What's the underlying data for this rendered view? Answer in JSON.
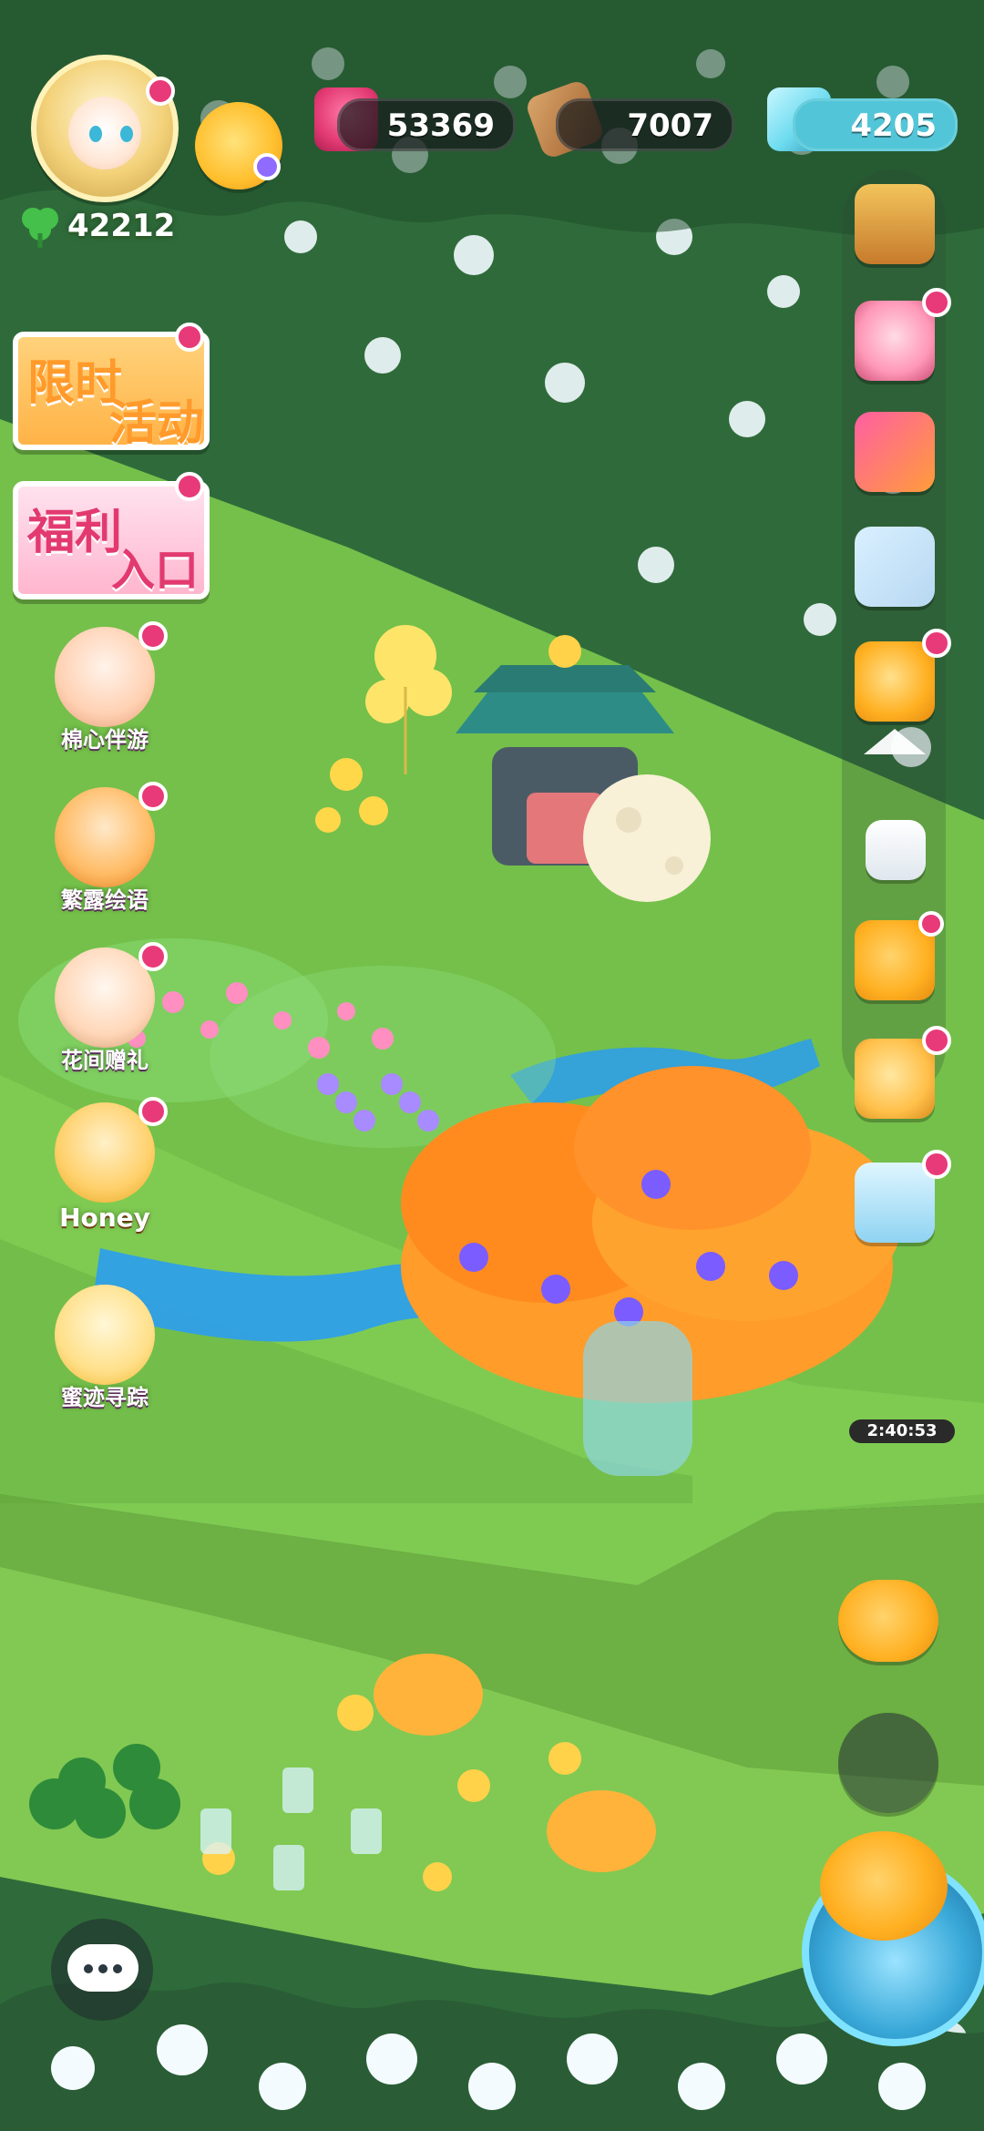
{
  "hud": {
    "player_level": "42212",
    "resources": {
      "jam": "53369",
      "wood": "7007",
      "gems": "4205"
    }
  },
  "left_menu": {
    "limited_event": {
      "line1": "限时",
      "line2": "活动"
    },
    "welfare": {
      "line1": "福利",
      "line2": "入口"
    },
    "items": [
      {
        "label": "棉心伴游"
      },
      {
        "label": "繁露绘语"
      },
      {
        "label": "花间赠礼"
      },
      {
        "label": "Honey"
      },
      {
        "label": "蜜迹寻踪"
      }
    ]
  },
  "right_rail": {
    "icons": [
      "treasure-chest-icon",
      "bear-plush-icon",
      "book-icon",
      "game-controller-icon",
      "duck-shop-icon",
      "collapse-arrow-icon",
      "camera-icon",
      "phone-icon",
      "bread-icon",
      "tv-icon"
    ],
    "timer": "2:40:53"
  },
  "colors": {
    "notify_dot": "#e83a78",
    "jam": "#e33a73",
    "gem_bar": "#52c6d8",
    "grass": "#69b83b",
    "snow_tree": "#2f6b3a"
  }
}
